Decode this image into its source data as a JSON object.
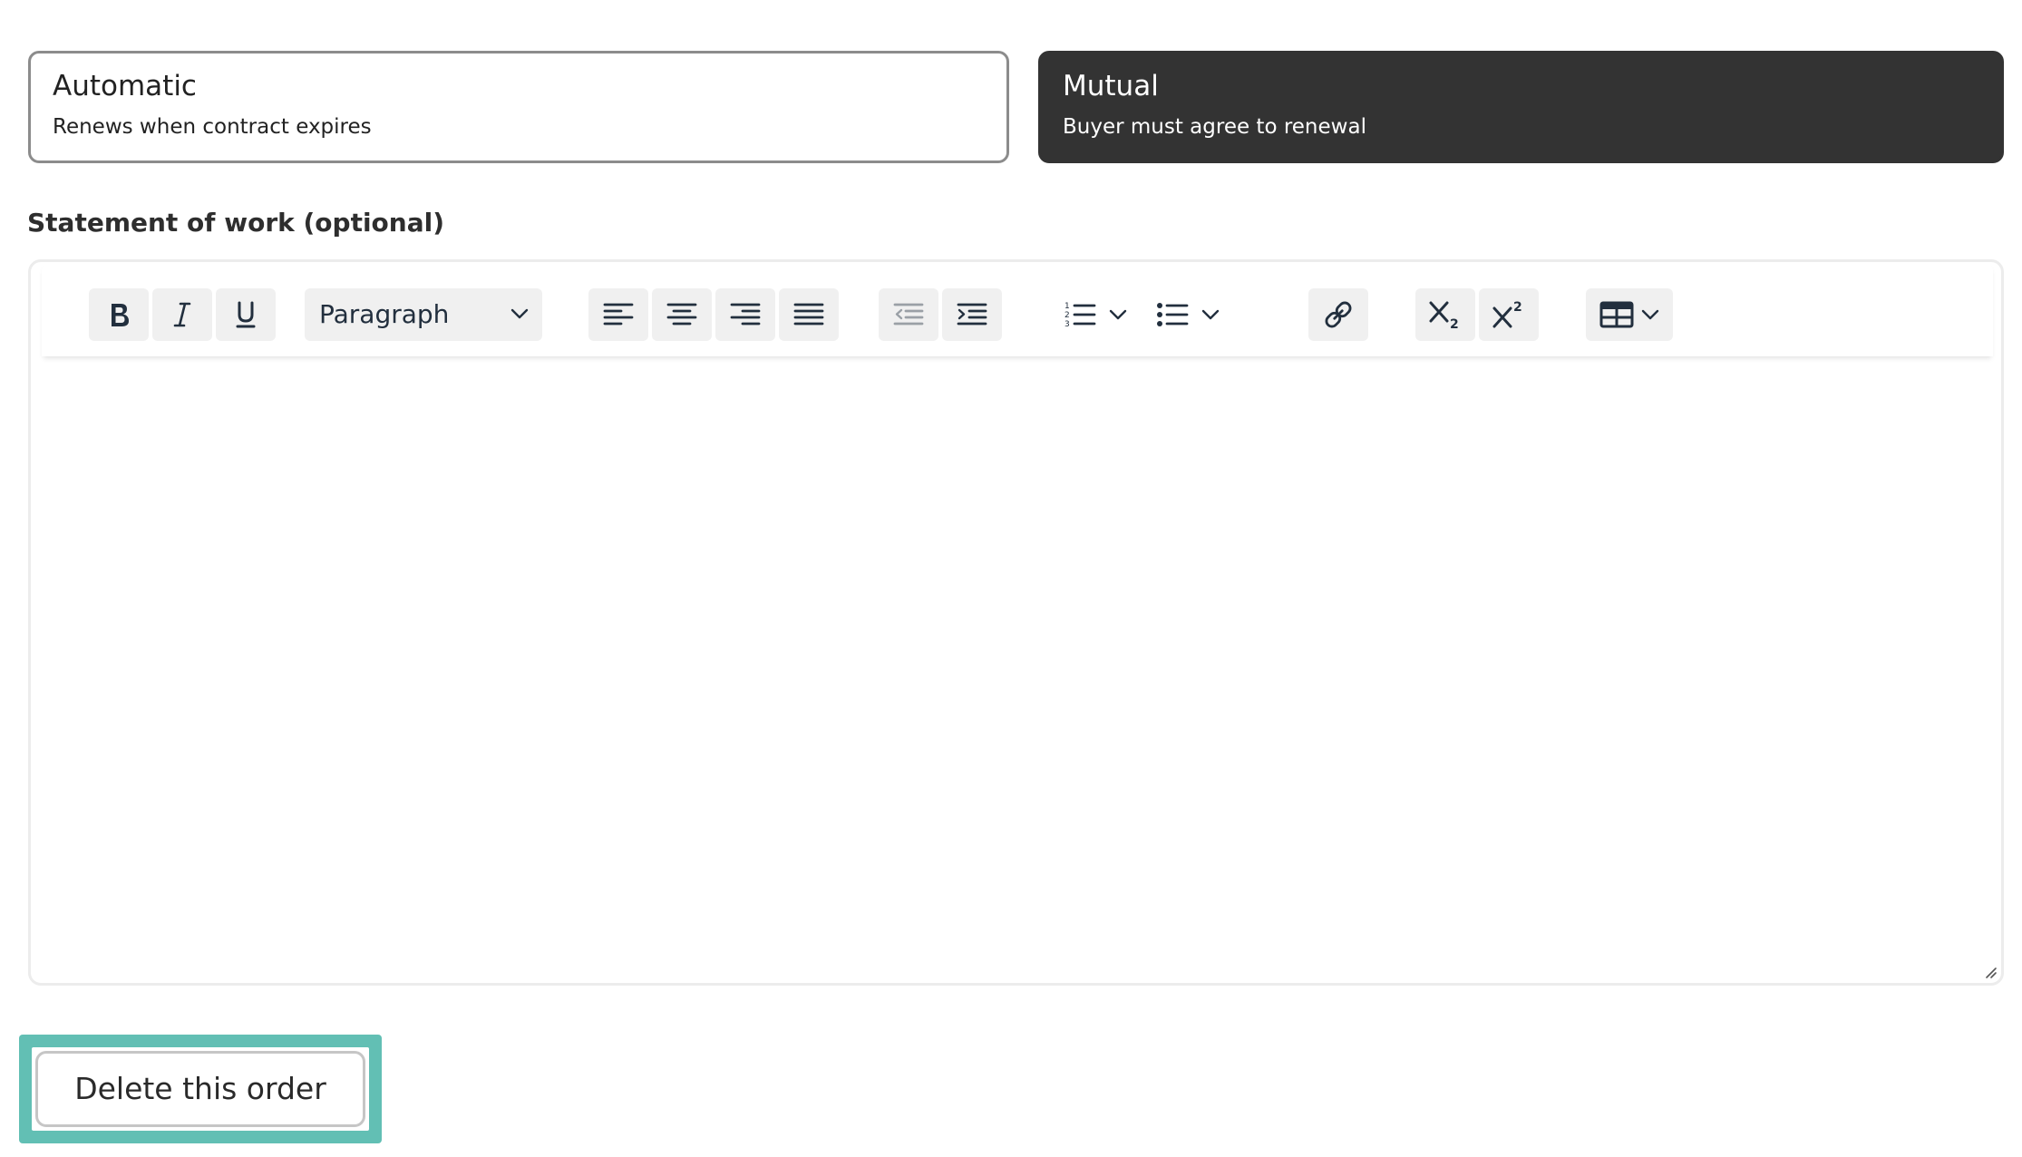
{
  "renewal_options": {
    "automatic": {
      "title": "Automatic",
      "description": "Renews when contract expires",
      "selected": false
    },
    "mutual": {
      "title": "Mutual",
      "description": "Buyer must agree to renewal",
      "selected": true
    }
  },
  "statement_of_work": {
    "label": "Statement of work (optional)",
    "value": "",
    "toolbar": {
      "bold": "bold-icon",
      "italic": "italic-icon",
      "underline": "underline-icon",
      "block_format": "Paragraph",
      "align_left": "align-left-icon",
      "align_center": "align-center-icon",
      "align_right": "align-right-icon",
      "align_justify": "align-justify-icon",
      "outdent": "outdent-icon",
      "indent": "indent-icon",
      "numbered_list": "numbered-list-icon",
      "bulleted_list": "bulleted-list-icon",
      "link": "link-icon",
      "subscript": "subscript-icon",
      "superscript": "superscript-icon",
      "table": "table-icon"
    }
  },
  "actions": {
    "delete_label": "Delete this order"
  },
  "colors": {
    "selected_card_bg": "#333333",
    "focus_ring": "#62bfb4",
    "toolbar_button_bg": "#f0f0f0"
  }
}
